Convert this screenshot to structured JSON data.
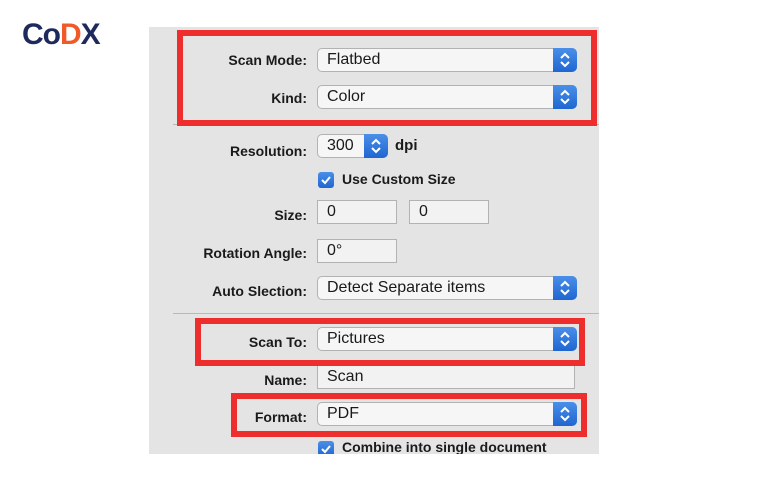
{
  "logo": {
    "part1": "Co",
    "part2": "D",
    "part3": "X"
  },
  "colors": {
    "accent": "#1f66d1",
    "highlight": "#ee2d2d",
    "panel": "#e4e4e4"
  },
  "icons": {
    "stepper": "up-down-chevron-icon",
    "checkbox": "checkmark-icon"
  },
  "scan_mode": {
    "label": "Scan Mode:",
    "value": "Flatbed"
  },
  "kind": {
    "label": "Kind:",
    "value": "Color"
  },
  "resolution": {
    "label": "Resolution:",
    "value": "300",
    "unit": "dpi"
  },
  "custom_size": {
    "label": "Use Custom Size",
    "checked": true
  },
  "size": {
    "label": "Size:",
    "width": "0",
    "height": "0"
  },
  "rotation": {
    "label": "Rotation Angle:",
    "value": "0°"
  },
  "auto_selection": {
    "label": "Auto Slection:",
    "value": "Detect Separate items"
  },
  "scan_to": {
    "label": "Scan To:",
    "value": "Pictures"
  },
  "name": {
    "label": "Name:",
    "value": "Scan"
  },
  "format": {
    "label": "Format:",
    "value": "PDF"
  },
  "combine": {
    "label": "Combine into single document",
    "checked": true
  }
}
